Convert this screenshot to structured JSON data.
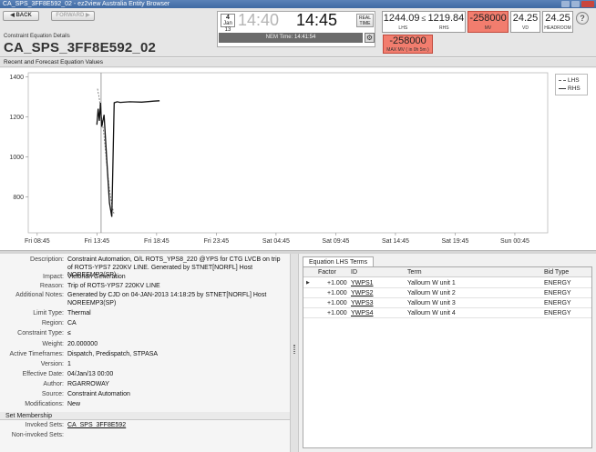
{
  "window": {
    "title": "CA_SPS_3FF8E592_02 - ez2view Australia Entity Browser"
  },
  "nav": {
    "back_label": "◀ BACK",
    "forward_label": "FORWARD ▶"
  },
  "header": {
    "subtitle": "Constraint Equation Details",
    "title": "CA_SPS_3FF8E592_02"
  },
  "clock": {
    "date_day": "4",
    "date_month": "Jan 13",
    "time_prev": "14:40",
    "time_now": "14:45",
    "realtime_label_1": "REAL",
    "realtime_label_2": "TIME",
    "nem_label": "NEM Time:",
    "nem_time": "14:41:54"
  },
  "metrics": {
    "lhs_value": "1244.09",
    "le_symbol": "≤",
    "rhs_value": "1219.84",
    "lhs_label": "LHS",
    "rhs_label": "RHS",
    "mv_value": "-258000",
    "mv_label": "MV",
    "vd_value": "24.25",
    "vd_label": "VD",
    "headroom_value": "24.25",
    "headroom_label": "HEADROOM",
    "max_mv_value": "-258000",
    "max_mv_label": "MAX MV ( in 0h 5m )",
    "red_color": "#f27d6e"
  },
  "chart_section": {
    "title": "Recent and Forecast Equation Values"
  },
  "chart_data": {
    "type": "line",
    "title": "",
    "xlabel": "",
    "ylabel": "",
    "x_ticks": [
      "Fri 08:45",
      "Fri 13:45",
      "Fri 18:45",
      "Fri 23:45",
      "Sat 04:45",
      "Sat 09:45",
      "Sat 14:45",
      "Sat 19:45",
      "Sun 00:45"
    ],
    "x_tick_hours": [
      8.75,
      13.75,
      18.75,
      23.75,
      28.75,
      33.75,
      38.75,
      43.75,
      48.75
    ],
    "xlim": [
      8.0,
      51.5
    ],
    "ylim": [
      620,
      1420
    ],
    "y_ticks": [
      800,
      1000,
      1200,
      1400
    ],
    "grid": false,
    "legend_position": "top-right",
    "current_time_hour": 14.1,
    "series": [
      {
        "name": "LHS",
        "style": "dashed",
        "x": [
          13.8,
          13.95,
          14.1,
          14.3,
          14.5,
          14.75,
          15.0,
          15.2
        ],
        "y": [
          1340,
          1290,
          1210,
          1130,
          1010,
          860,
          760,
          710
        ]
      },
      {
        "name": "RHS",
        "style": "solid",
        "x": [
          13.75,
          13.85,
          13.95,
          14.05,
          14.15,
          14.35,
          14.6,
          14.8,
          15.0,
          15.2,
          15.45,
          15.7,
          16.5,
          17.5,
          18.5,
          19.0
        ],
        "y": [
          1160,
          1240,
          1180,
          1270,
          1150,
          1210,
          960,
          770,
          700,
          1270,
          1275,
          1272,
          1275,
          1273,
          1278,
          1280
        ]
      }
    ]
  },
  "details": {
    "rows": [
      {
        "label": "Description:",
        "value": "Constraint Automation, O/L ROTS_YPS8_220 @YPS for CTG LVCB on trip of ROTS-YPS7 220KV LINE.  Generated by STNET[NORFL] Host NOREEMP3(SP)"
      },
      {
        "label": "Impact:",
        "value": "Victorian Generation"
      },
      {
        "label": "Reason:",
        "value": "Trip of ROTS-YPS7 220KV LINE"
      },
      {
        "label": "Additional Notes:",
        "value": "Generated by CJD on 04-JAN-2013 14:18:25 by STNET[NORFL] Host NOREEMP3(SP)"
      },
      {
        "label": "Limit Type:",
        "value": "Thermal"
      },
      {
        "label": "Region:",
        "value": "CA"
      },
      {
        "label": "Constraint Type:",
        "value": "≤"
      },
      {
        "label": "Weight:",
        "value": "20.000000"
      },
      {
        "label": "Active Timeframes:",
        "value": "Dispatch, Predispatch, STPASA"
      },
      {
        "label": "Version:",
        "value": "1"
      },
      {
        "label": "Effective Date:",
        "value": "04/Jan/13 00:00"
      },
      {
        "label": "Author:",
        "value": "RGARROWAY"
      },
      {
        "label": "Source:",
        "value": "Constraint Automation"
      },
      {
        "label": "Modifications:",
        "value": "New"
      }
    ],
    "membership_header": "Set Membership",
    "invoked_label": "Invoked Sets:",
    "invoked_value": "CA_SPS_3FF8E592",
    "noninvoked_label": "Non-invoked Sets:"
  },
  "terms": {
    "tab_label": "Equation LHS Terms",
    "columns": [
      "Factor",
      "ID",
      "Term",
      "Bid Type"
    ],
    "selected_marker": "▶",
    "rows": [
      {
        "factor": "+1.000",
        "id": "YWPS1",
        "term": "Yallourn W unit 1",
        "bid_type": "ENERGY"
      },
      {
        "factor": "+1.000",
        "id": "YWPS2",
        "term": "Yallourn W unit 2",
        "bid_type": "ENERGY"
      },
      {
        "factor": "+1.000",
        "id": "YWPS3",
        "term": "Yallourn W unit 3",
        "bid_type": "ENERGY"
      },
      {
        "factor": "+1.000",
        "id": "YWPS4",
        "term": "Yallourn W unit 4",
        "bid_type": "ENERGY"
      }
    ]
  }
}
